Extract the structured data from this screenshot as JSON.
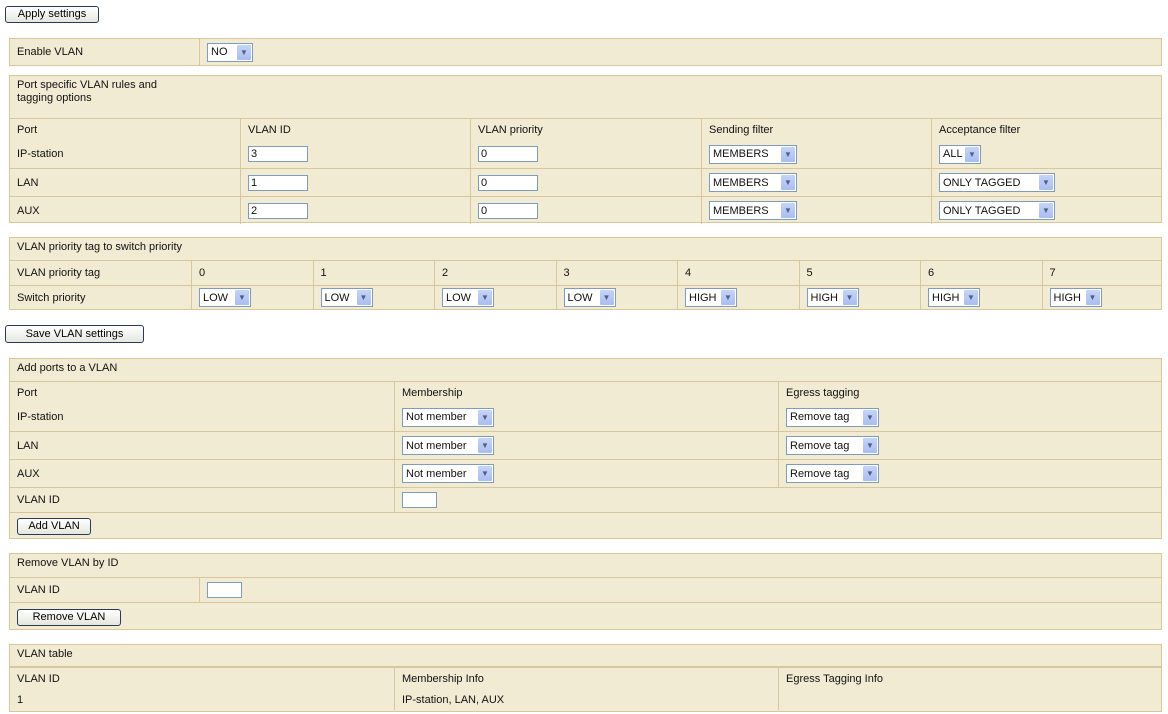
{
  "apply_button": "Apply settings",
  "enable_vlan": {
    "label": "Enable VLAN",
    "value": "NO"
  },
  "port_rules": {
    "title": "Port specific VLAN rules and tagging options",
    "title_line1": "Port specific VLAN rules and",
    "title_line2": "tagging options",
    "headers": [
      "Port",
      "VLAN ID",
      "VLAN priority",
      "Sending filter",
      "Acceptance filter"
    ],
    "rows": [
      {
        "port": "IP-station",
        "vlan_id": "3",
        "priority": "0",
        "sending": "MEMBERS",
        "acceptance": "ALL"
      },
      {
        "port": "LAN",
        "vlan_id": "1",
        "priority": "0",
        "sending": "MEMBERS",
        "acceptance": "ONLY TAGGED"
      },
      {
        "port": "AUX",
        "vlan_id": "2",
        "priority": "0",
        "sending": "MEMBERS",
        "acceptance": "ONLY TAGGED"
      }
    ]
  },
  "priority_map": {
    "title": "VLAN priority tag to switch priority",
    "tag_label": "VLAN priority tag",
    "switch_label": "Switch priority",
    "tags": [
      "0",
      "1",
      "2",
      "3",
      "4",
      "5",
      "6",
      "7"
    ],
    "values": [
      "LOW",
      "LOW",
      "LOW",
      "LOW",
      "HIGH",
      "HIGH",
      "HIGH",
      "HIGH"
    ]
  },
  "save_button": "Save VLAN settings",
  "add_ports": {
    "title": "Add ports to a VLAN",
    "headers": [
      "Port",
      "Membership",
      "Egress tagging"
    ],
    "rows": [
      {
        "port": "IP-station",
        "membership": "Not member",
        "egress": "Remove tag"
      },
      {
        "port": "LAN",
        "membership": "Not member",
        "egress": "Remove tag"
      },
      {
        "port": "AUX",
        "membership": "Not member",
        "egress": "Remove tag"
      }
    ],
    "vlan_id_label": "VLAN ID",
    "vlan_id_value": "",
    "button": "Add VLAN"
  },
  "remove_vlan": {
    "title": "Remove VLAN by ID",
    "vlan_id_label": "VLAN ID",
    "vlan_id_value": "",
    "button": "Remove VLAN"
  },
  "vlan_table": {
    "title": "VLAN table",
    "headers": [
      "VLAN ID",
      "Membership Info",
      "Egress Tagging Info"
    ],
    "rows": [
      {
        "id": "1",
        "membership": "IP-station, LAN, AUX",
        "egress": ""
      }
    ]
  }
}
